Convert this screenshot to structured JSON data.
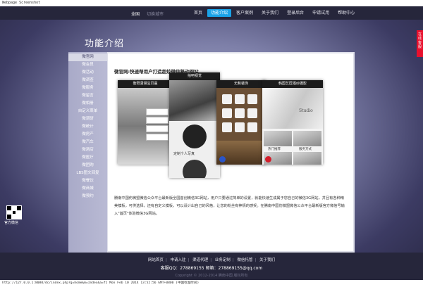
{
  "capture": {
    "title": "Webpage Screenshot",
    "footer": "http://127.0.0.1:8080/dc/index.php?g=home&m=Index&a=fz    Mon Feb 10 2014 13:52:56 GMT+0800 (中国标准时间)"
  },
  "topbar": {
    "left": [
      "全国",
      "切换城市"
    ],
    "nav": [
      "首页",
      "功能介绍",
      "客户案例",
      "关于我们",
      "登录后台",
      "申请试用",
      "帮助中心"
    ],
    "active_index": 1
  },
  "page": {
    "title": "功能介绍"
  },
  "side_tab": {
    "label": "在线客服"
  },
  "sidebar": {
    "items": [
      "微官网",
      "微会员",
      "微活动",
      "微调查",
      "微服务",
      "微留言",
      "微相册",
      "自定义菜单",
      "微调研",
      "微统计",
      "微房产",
      "微汽车",
      "微酒店",
      "微医疗",
      "微团购",
      "LBS图文回复",
      "微餐饮",
      "微商城",
      "微预约"
    ]
  },
  "content": {
    "heading": "微官网:快速帮用户打造超炫微信移动网站",
    "phones": {
      "p1_title": "衡阳潇湘宝贝童",
      "p2_title": "拍吧视觉",
      "p2_caption": "定制个人写真",
      "p3_title": "无和装饰",
      "p4_title": "韩国艺匠婚纱摄影",
      "p4_brand": "Studio",
      "p4_tab1": "热门推荐",
      "p4_tab2": "服务方式"
    },
    "paragraph": "腾南中国伤微盟微信公众平台最新版全国首创微信3G网站，用户只要通过简单的设置，就能快速生成属于您自己的微信3G网站，并且有各种精美模板，可供选择，还有自定义模板，可以设计出自己的风格，让您的粉丝有神情的感受。在腾南中国伤微盟微信公众平台最新版官方微信号输入\"首页\"体验微信3G网站。"
  },
  "qr": {
    "label": "官方微信"
  },
  "footer": {
    "links": [
      "网站首页",
      "申请入驻",
      "渠道代理",
      "业务定制",
      "微信托管",
      "关于我们"
    ],
    "contact": "客服QQ：278869155    邮箱：278869155@qq.com",
    "copyright": "Copyright © 2012-2014 腾南中国 版权所有"
  }
}
